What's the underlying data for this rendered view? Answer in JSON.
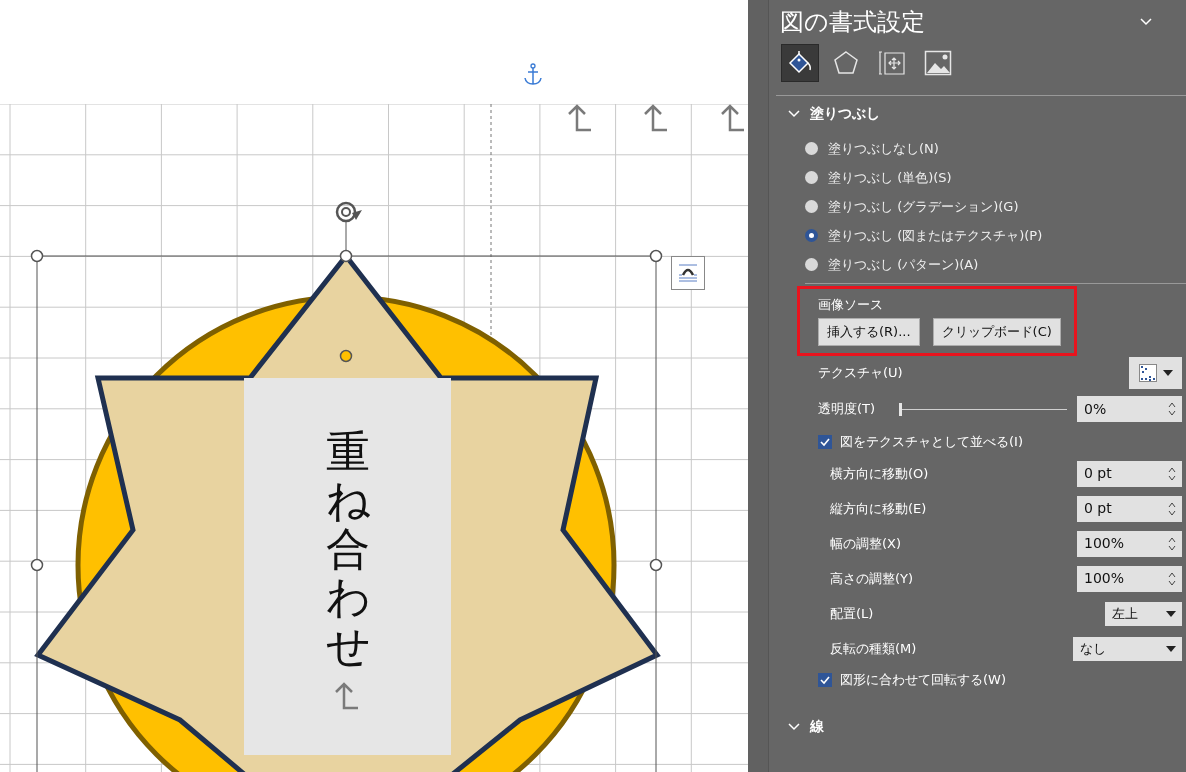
{
  "canvas": {
    "vertical_text": "重ね合わせ"
  },
  "panel": {
    "title": "図の書式設定",
    "tabs": [
      {
        "kind": "fill",
        "selected": true
      },
      {
        "kind": "shape",
        "selected": false
      },
      {
        "kind": "layout",
        "selected": false
      },
      {
        "kind": "picture",
        "selected": false
      }
    ],
    "fill_section": {
      "title": "塗りつぶし",
      "options": [
        {
          "label": "塗りつぶしなし(N)",
          "selected": false
        },
        {
          "label": "塗りつぶし (単色)(S)",
          "selected": false
        },
        {
          "label": "塗りつぶし (グラデーション)(G)",
          "selected": false
        },
        {
          "label": "塗りつぶし (図またはテクスチャ)(P)",
          "selected": true
        },
        {
          "label": "塗りつぶし (パターン)(A)",
          "selected": false
        }
      ],
      "image_source": {
        "label": "画像ソース",
        "buttons": [
          "挿入する(R)...",
          "クリップボード(C)"
        ]
      },
      "texture": {
        "label": "テクスチャ(U)"
      },
      "transparency": {
        "label": "透明度(T)",
        "level": 0,
        "value": "0%"
      },
      "tile": {
        "label": "図をテクスチャとして並べる(I)",
        "checked": true
      },
      "fields": [
        {
          "kind": "spin",
          "label": "横方向に移動(O)",
          "value": "0 pt"
        },
        {
          "kind": "spin",
          "label": "縦方向に移動(E)",
          "value": "0 pt"
        },
        {
          "kind": "spin",
          "label": "幅の調整(X)",
          "value": "100%"
        },
        {
          "kind": "spin",
          "label": "高さの調整(Y)",
          "value": "100%"
        },
        {
          "kind": "dropdown",
          "label": "配置(L)",
          "value": "左上"
        },
        {
          "kind": "dropdown",
          "label": "反転の種類(M)",
          "value": "なし"
        }
      ],
      "rotate": {
        "label": "図形に合わせて回転する(W)",
        "checked": true
      }
    },
    "line_section": {
      "title": "線"
    }
  }
}
